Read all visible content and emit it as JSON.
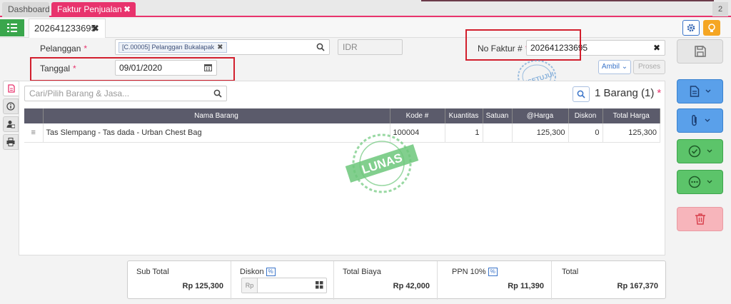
{
  "tabs": {
    "dashboard": "Dashboard",
    "faktur": "Faktur Penjualan",
    "close": "✖",
    "count": "2"
  },
  "doc_tab": {
    "label": "202641233695",
    "close": "✖"
  },
  "form": {
    "pelanggan_label": "Pelanggan",
    "pelanggan_value": "[C.00005] Pelanggan Bukalapak",
    "tag_close": "✖",
    "currency": "IDR",
    "tanggal_label": "Tanggal",
    "tanggal_value": "09/01/2020",
    "no_faktur_label": "No Faktur #",
    "no_faktur_value": "202641233695",
    "clear": "✖",
    "required": "*"
  },
  "buttons": {
    "ambil": "Ambil",
    "proses": "Proses"
  },
  "stamps": {
    "disetujui": "DISETUJUI",
    "lunas": "LUNAS"
  },
  "items": {
    "search_placeholder": "Cari/Pilih Barang & Jasa...",
    "count_label": "1 Barang (1)",
    "columns": [
      "Nama Barang",
      "Kode #",
      "Kuantitas",
      "Satuan",
      "@Harga",
      "Diskon",
      "Total Harga"
    ],
    "rows": [
      {
        "handle": "≡",
        "name": "Tas Slempang - Tas dada - Urban Chest Bag",
        "code": "100004",
        "qty": "1",
        "unit": "",
        "price": "125,300",
        "discount": "0",
        "total": "125,300"
      }
    ]
  },
  "totals": {
    "subtotal_label": "Sub Total",
    "subtotal_value": "Rp 125,300",
    "diskon_label": "Diskon",
    "pct": "%",
    "diskon_prefix": "Rp",
    "biaya_label": "Total Biaya",
    "biaya_value": "Rp 42,000",
    "ppn_label": "PPN 10%",
    "ppn_value": "Rp 11,390",
    "total_label": "Total",
    "total_value": "Rp 167,370"
  },
  "colors": {
    "brand_pink": "#e8336d",
    "menu_green": "#3aa64c",
    "header_gray": "#5b5b6b",
    "highlight_red": "#d21f2d",
    "stamp_green": "#6cc77a",
    "stamp_blue": "#6a9fd4"
  },
  "icons": [
    "list-icon",
    "gear-icon",
    "lightbulb-icon",
    "search-icon",
    "calendar-icon",
    "save-icon",
    "document-icon",
    "info-icon",
    "user-card-icon",
    "printer-icon",
    "file-text-icon",
    "paperclip-icon",
    "check-circle-icon",
    "more-circle-icon",
    "trash-icon",
    "calculator-icon",
    "chevron-down-icon",
    "drag-handle-icon"
  ]
}
